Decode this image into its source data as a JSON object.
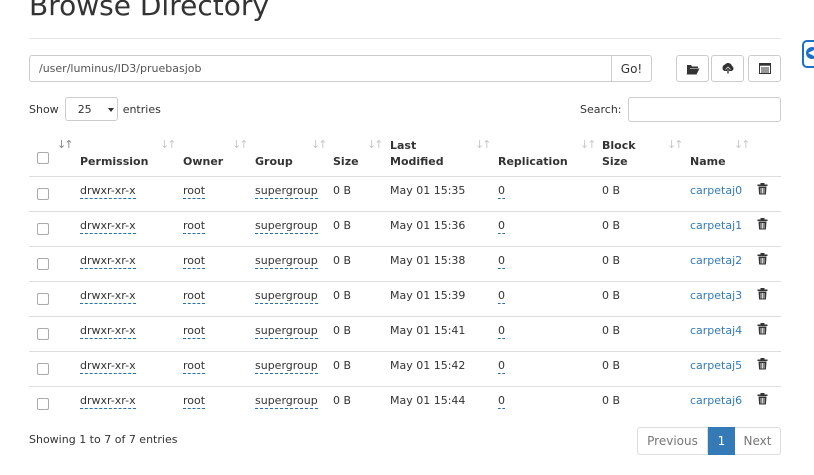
{
  "page": {
    "title": "Browse Directory"
  },
  "toolbar": {
    "path_value": "/user/luminus/ID3/pruebasjob",
    "go_label": "Go!",
    "icons": [
      "folder-open-icon",
      "upload-icon",
      "table-icon"
    ]
  },
  "table_controls": {
    "show_label": "Show",
    "page_size": "25",
    "entries_label": "entries",
    "search_label": "Search:"
  },
  "table": {
    "columns": [
      "Permission",
      "Owner",
      "Group",
      "Size",
      "Last",
      "Modified",
      "Replication",
      "Block",
      "Size",
      "Name"
    ],
    "rows": [
      {
        "permission": "drwxr-xr-x",
        "owner": "root",
        "group": "supergroup",
        "size": "0 B",
        "modified": "May 01 15:35",
        "replication": "0",
        "block_size": "0 B",
        "name": "carpetaj0"
      },
      {
        "permission": "drwxr-xr-x",
        "owner": "root",
        "group": "supergroup",
        "size": "0 B",
        "modified": "May 01 15:36",
        "replication": "0",
        "block_size": "0 B",
        "name": "carpetaj1"
      },
      {
        "permission": "drwxr-xr-x",
        "owner": "root",
        "group": "supergroup",
        "size": "0 B",
        "modified": "May 01 15:38",
        "replication": "0",
        "block_size": "0 B",
        "name": "carpetaj2"
      },
      {
        "permission": "drwxr-xr-x",
        "owner": "root",
        "group": "supergroup",
        "size": "0 B",
        "modified": "May 01 15:39",
        "replication": "0",
        "block_size": "0 B",
        "name": "carpetaj3"
      },
      {
        "permission": "drwxr-xr-x",
        "owner": "root",
        "group": "supergroup",
        "size": "0 B",
        "modified": "May 01 15:41",
        "replication": "0",
        "block_size": "0 B",
        "name": "carpetaj4"
      },
      {
        "permission": "drwxr-xr-x",
        "owner": "root",
        "group": "supergroup",
        "size": "0 B",
        "modified": "May 01 15:42",
        "replication": "0",
        "block_size": "0 B",
        "name": "carpetaj5"
      },
      {
        "permission": "drwxr-xr-x",
        "owner": "root",
        "group": "supergroup",
        "size": "0 B",
        "modified": "May 01 15:44",
        "replication": "0",
        "block_size": "0 B",
        "name": "carpetaj6"
      }
    ]
  },
  "footer": {
    "info": "Showing 1 to 7 of 7 entries",
    "prev_label": "Previous",
    "current_page": "1",
    "next_label": "Next"
  },
  "colors": {
    "link": "#337ab7",
    "active_page": "#337ab7",
    "side_tab": "#1a6fc9"
  }
}
